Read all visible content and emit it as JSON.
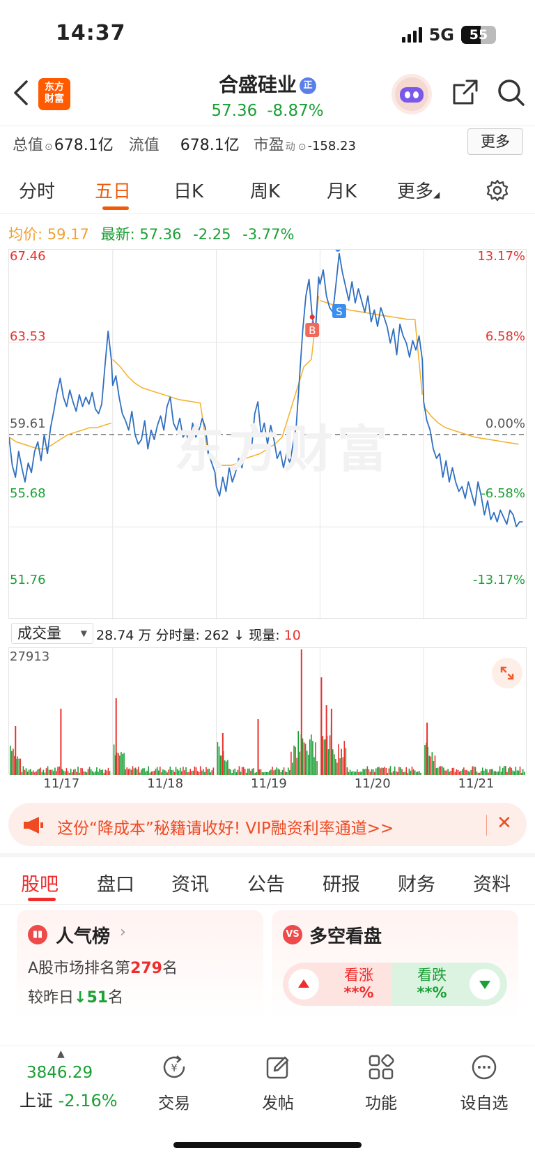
{
  "status": {
    "time": "14:37",
    "network": "5G",
    "battery": "55",
    "battery_level": 0.55
  },
  "header": {
    "logo_line1": "东方",
    "logo_line2": "财富",
    "stock_name": "合盛硅业",
    "badge": "正",
    "price": "57.36",
    "change_pct": "-8.87%"
  },
  "info": {
    "total_cap_label": "总值",
    "total_cap": "678.1亿",
    "float_cap_label": "流值",
    "float_cap": "678.1亿",
    "pe_label": "市盈",
    "pe_sup": "动",
    "pe_value": "-158.23",
    "more_button": "更多"
  },
  "period_tabs": [
    "分时",
    "五日",
    "日K",
    "周K",
    "月K",
    "更多"
  ],
  "price_line": {
    "avg_label": "均价:",
    "avg_value": "59.17",
    "latest_label": "最新:",
    "latest_value": "57.36",
    "change": "-2.25",
    "change_pct": "-3.77%"
  },
  "chart_data": {
    "type": "line",
    "y_left_ticks": [
      "67.46",
      "63.53",
      "59.61",
      "55.68",
      "51.76"
    ],
    "y_right_ticks": [
      "13.17%",
      "6.58%",
      "0.00%",
      "-6.58%",
      "-13.17%"
    ],
    "ylim": [
      51.76,
      67.46
    ],
    "prev_close": 59.61,
    "x_days": [
      "11/17",
      "11/18",
      "11/19",
      "11/20",
      "11/21"
    ],
    "markers": [
      "B",
      "S"
    ],
    "series": [
      {
        "values": [
          59.5,
          58.3,
          57.8,
          58.9,
          58.2,
          57.6,
          58.4,
          58.0,
          58.9,
          59.3,
          58.5,
          59.6,
          58.8,
          59.9,
          60.6,
          61.4,
          62.0,
          61.2,
          60.8,
          61.5,
          61.0,
          60.6,
          61.3,
          60.8,
          61.2,
          60.9,
          61.4,
          60.7,
          60.5,
          60.9,
          62.5,
          64.0,
          62.8,
          61.7,
          62.1,
          61.2,
          60.5,
          60.2,
          59.8,
          60.6,
          59.6,
          59.2,
          59.4,
          60.2,
          59.0,
          59.8,
          59.4,
          60.0,
          60.4,
          59.8,
          60.8,
          61.2,
          60.1,
          59.8,
          60.3,
          59.5,
          59.7,
          59.2,
          60.1,
          59.5,
          59.8,
          60.3,
          59.9,
          58.8,
          58.4,
          58.0,
          57.4,
          57.0,
          57.8,
          57.2,
          58.2,
          57.6,
          58.0,
          58.6,
          58.2,
          58.9,
          59.2,
          59.0,
          60.5,
          61.0,
          59.6,
          60.1,
          59.2,
          60.0,
          59.4,
          58.6,
          58.9,
          58.2,
          58.8,
          58.4,
          59.2,
          60.0,
          62.0,
          64.0,
          65.5,
          66.2,
          64.6,
          63.9,
          66.3,
          66.0,
          66.6,
          65.5,
          65.0,
          64.8,
          66.0,
          67.3,
          66.5,
          65.9,
          65.3,
          66.1,
          65.2,
          65.8,
          65.3,
          64.8,
          65.5,
          64.4,
          64.9,
          64.2,
          65.0,
          64.6,
          64.2,
          63.5,
          64.1,
          63.0,
          64.3,
          63.8,
          63.5,
          62.9,
          63.6,
          63.2,
          63.8,
          62.8,
          61.0,
          60.2,
          59.8,
          59.0,
          58.6,
          58.8,
          57.8,
          58.5,
          57.6,
          58.2,
          57.6,
          57.2,
          57.4,
          56.9,
          57.6,
          57.1,
          56.6,
          57.6,
          57.0,
          56.2,
          56.8,
          56.0,
          56.3,
          55.9,
          56.4,
          56.1,
          55.8,
          56.4,
          56.2,
          55.7,
          55.9,
          55.9
        ]
      },
      {
        "name": "均价",
        "values": [
          59.5,
          59.3,
          59.2,
          59.1,
          59.0,
          59.0,
          59.2,
          59.4,
          59.6,
          59.7,
          59.8,
          59.9,
          59.9,
          60.0,
          60.1,
          62.8,
          62.5,
          62.1,
          61.8,
          61.6,
          61.5,
          61.4,
          61.3,
          61.2,
          61.1,
          61.05,
          61.0,
          60.95,
          58.8,
          58.4,
          58.3,
          58.3,
          58.3,
          58.4,
          58.6,
          58.7,
          58.8,
          59.0,
          59.2,
          59.5,
          60.5,
          61.5,
          62.5,
          62.8,
          65.5,
          65.3,
          65.2,
          65.1,
          65.0,
          64.9,
          64.85,
          64.8,
          64.75,
          64.7,
          64.65,
          64.6,
          64.55,
          64.5,
          64.5,
          61.3,
          60.8,
          60.4,
          60.1,
          59.9,
          59.8,
          59.7,
          59.6,
          59.5,
          59.45,
          59.4,
          59.35,
          59.3,
          59.25,
          59.2
        ]
      }
    ]
  },
  "volume": {
    "selector": "成交量",
    "total_label": "28.74 万",
    "minute_label": "分时量:",
    "minute_value": "262",
    "current_label": "现量:",
    "current_value": "10",
    "max_label": "27913"
  },
  "banner": {
    "text": "这份“降成本”秘籍请收好! VIP融资利率通道>>",
    "close": "✕"
  },
  "bottom_tabs": [
    "股吧",
    "盘口",
    "资讯",
    "公告",
    "研报",
    "财务",
    "资料"
  ],
  "popularity": {
    "title": "人气榜",
    "rank_prefix": "A股市场排名第",
    "rank": "279",
    "rank_suffix": "名",
    "compare_prefix": "较昨日",
    "compare_value": "51",
    "compare_suffix": "名"
  },
  "sentiment": {
    "title": "多空看盘",
    "icon": "VS",
    "up_label": "看涨",
    "up_value": "**%",
    "down_label": "看跌",
    "down_value": "**%"
  },
  "bottom_nav": {
    "index_value": "3846.29",
    "index_name": "上证",
    "index_change": "-2.16%",
    "items": [
      "交易",
      "发帖",
      "功能",
      "设自选"
    ]
  }
}
